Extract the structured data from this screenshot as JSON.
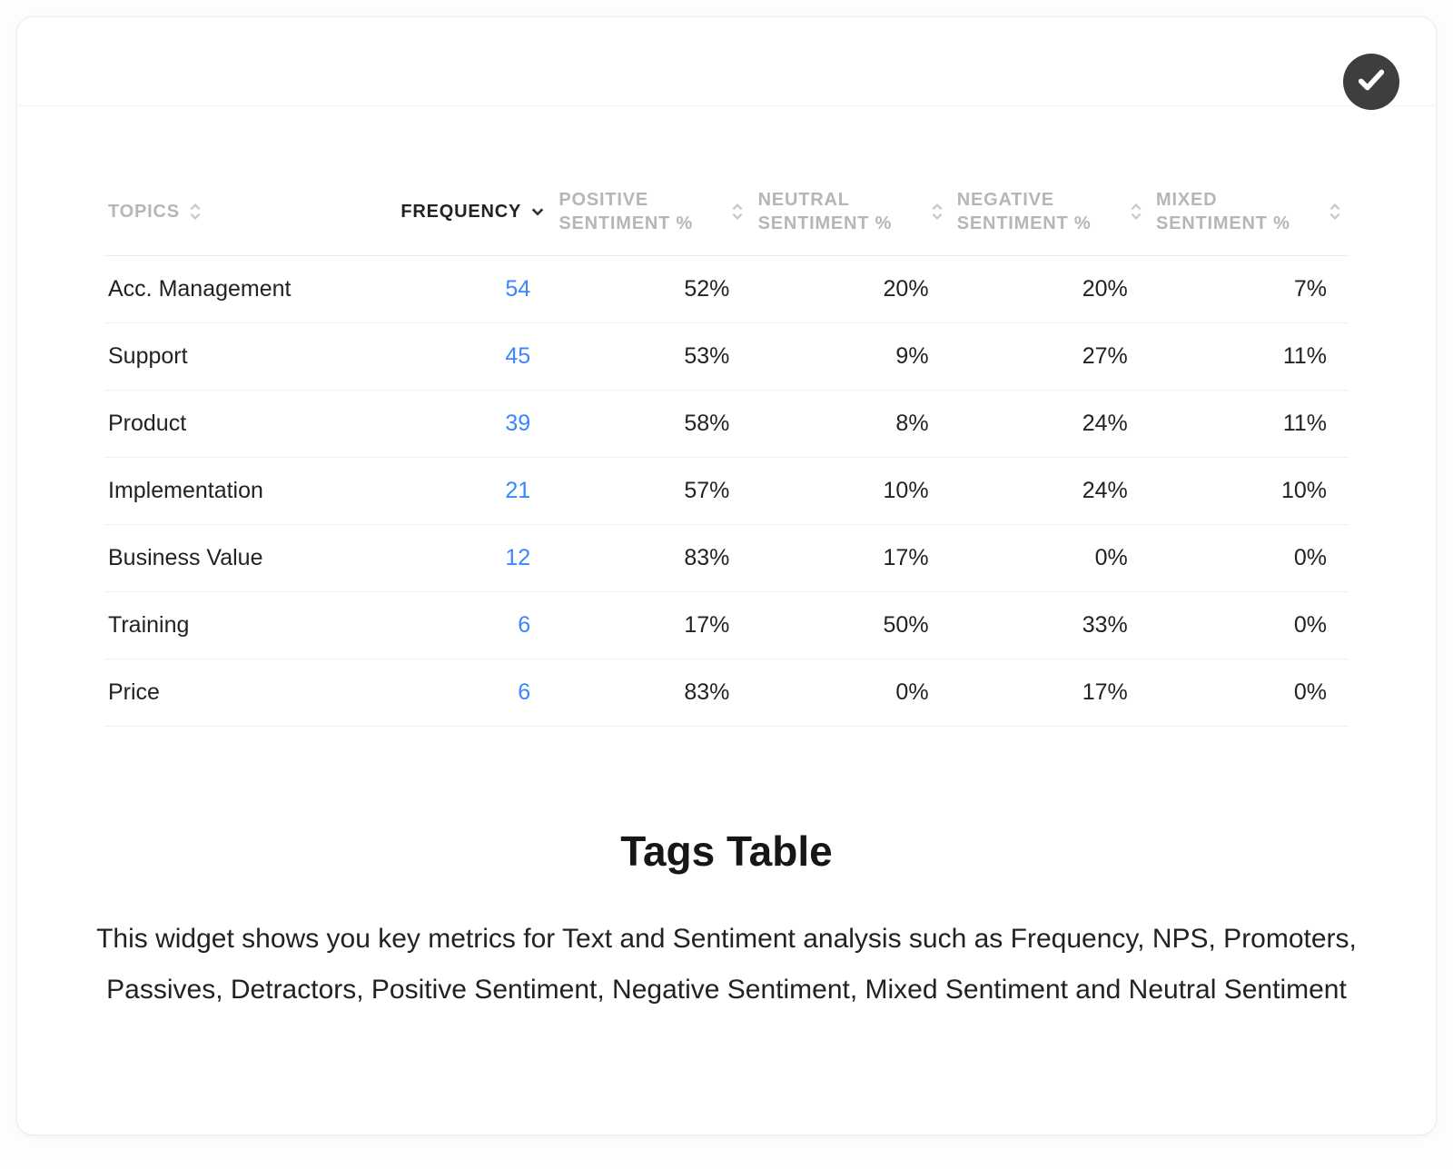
{
  "table": {
    "columns": [
      {
        "label": "TOPICS",
        "active": false,
        "sort": "both"
      },
      {
        "label": "FREQUENCY",
        "active": true,
        "sort": "desc"
      },
      {
        "label": "POSITIVE SENTIMENT %",
        "active": false,
        "sort": "both"
      },
      {
        "label": "NEUTRAL SENTIMENT %",
        "active": false,
        "sort": "both"
      },
      {
        "label": "NEGATIVE SENTIMENT %",
        "active": false,
        "sort": "both"
      },
      {
        "label": "MIXED SENTIMENT %",
        "active": false,
        "sort": "both"
      }
    ],
    "rows": [
      {
        "topic": "Acc. Management",
        "frequency": "54",
        "positive": "52%",
        "neutral": "20%",
        "negative": "20%",
        "mixed": "7%"
      },
      {
        "topic": "Support",
        "frequency": "45",
        "positive": "53%",
        "neutral": "9%",
        "negative": "27%",
        "mixed": "11%"
      },
      {
        "topic": "Product",
        "frequency": "39",
        "positive": "58%",
        "neutral": "8%",
        "negative": "24%",
        "mixed": "11%"
      },
      {
        "topic": "Implementation",
        "frequency": "21",
        "positive": "57%",
        "neutral": "10%",
        "negative": "24%",
        "mixed": "10%"
      },
      {
        "topic": "Business Value",
        "frequency": "12",
        "positive": "83%",
        "neutral": "17%",
        "negative": "0%",
        "mixed": "0%"
      },
      {
        "topic": "Training",
        "frequency": "6",
        "positive": "17%",
        "neutral": "50%",
        "negative": "33%",
        "mixed": "0%"
      },
      {
        "topic": "Price",
        "frequency": "6",
        "positive": "83%",
        "neutral": "0%",
        "negative": "17%",
        "mixed": "0%"
      }
    ]
  },
  "section": {
    "title": "Tags Table",
    "description": "This widget shows you key metrics for Text and Sentiment analysis such as Frequency, NPS, Promoters, Passives, Detractors, Positive Sentiment, Negative Sentiment, Mixed Sentiment and Neutral Sentiment"
  }
}
